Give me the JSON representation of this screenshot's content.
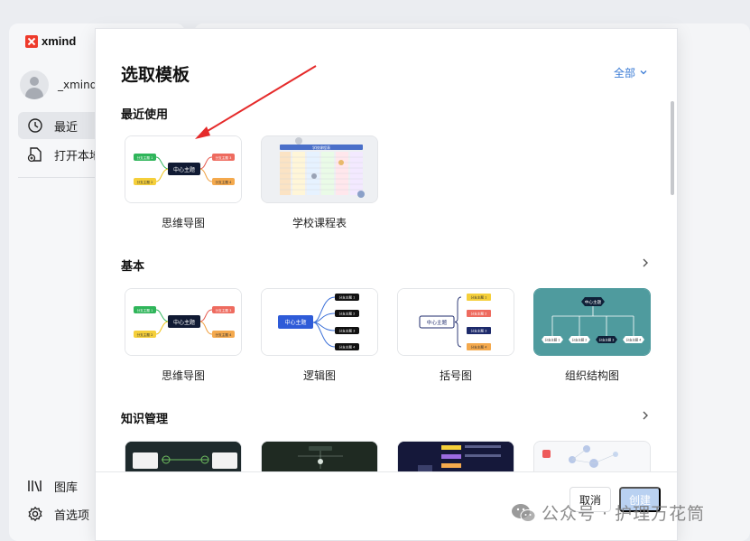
{
  "app": {
    "logo_text": "xmind",
    "brand_color": "#ee3a2b"
  },
  "sidebar": {
    "user_name": "_xmind_",
    "nav": [
      {
        "label": "最近",
        "icon": "clock-icon",
        "active": true
      },
      {
        "label": "打开本地",
        "icon": "open-file-icon",
        "active": false
      }
    ],
    "bottom_nav": [
      {
        "label": "图库",
        "icon": "library-icon"
      },
      {
        "label": "首选项",
        "icon": "gear-icon"
      }
    ]
  },
  "modal": {
    "title": "选取模板",
    "filter_label": "全部",
    "sections": [
      {
        "title": "最近使用",
        "templates": [
          {
            "label": "思维导图"
          },
          {
            "label": "学校课程表"
          }
        ]
      },
      {
        "title": "基本",
        "templates": [
          {
            "label": "思维导图"
          },
          {
            "label": "逻辑图"
          },
          {
            "label": "括号图"
          },
          {
            "label": "组织结构图"
          }
        ]
      },
      {
        "title": "知识管理",
        "templates": []
      }
    ],
    "thumbnails": {
      "center_topic": "中心主题",
      "branch": "分支主题",
      "branch_items": [
        "分支主题 1",
        "分支主题 2",
        "分支主题 3",
        "分支主题 4"
      ],
      "schedule_title": "学校课程表"
    },
    "cancel_label": "取消",
    "create_label": "创建",
    "accent_color": "#3a7bd5"
  },
  "watermark": {
    "text": "公众号 · 护理万花筒"
  }
}
